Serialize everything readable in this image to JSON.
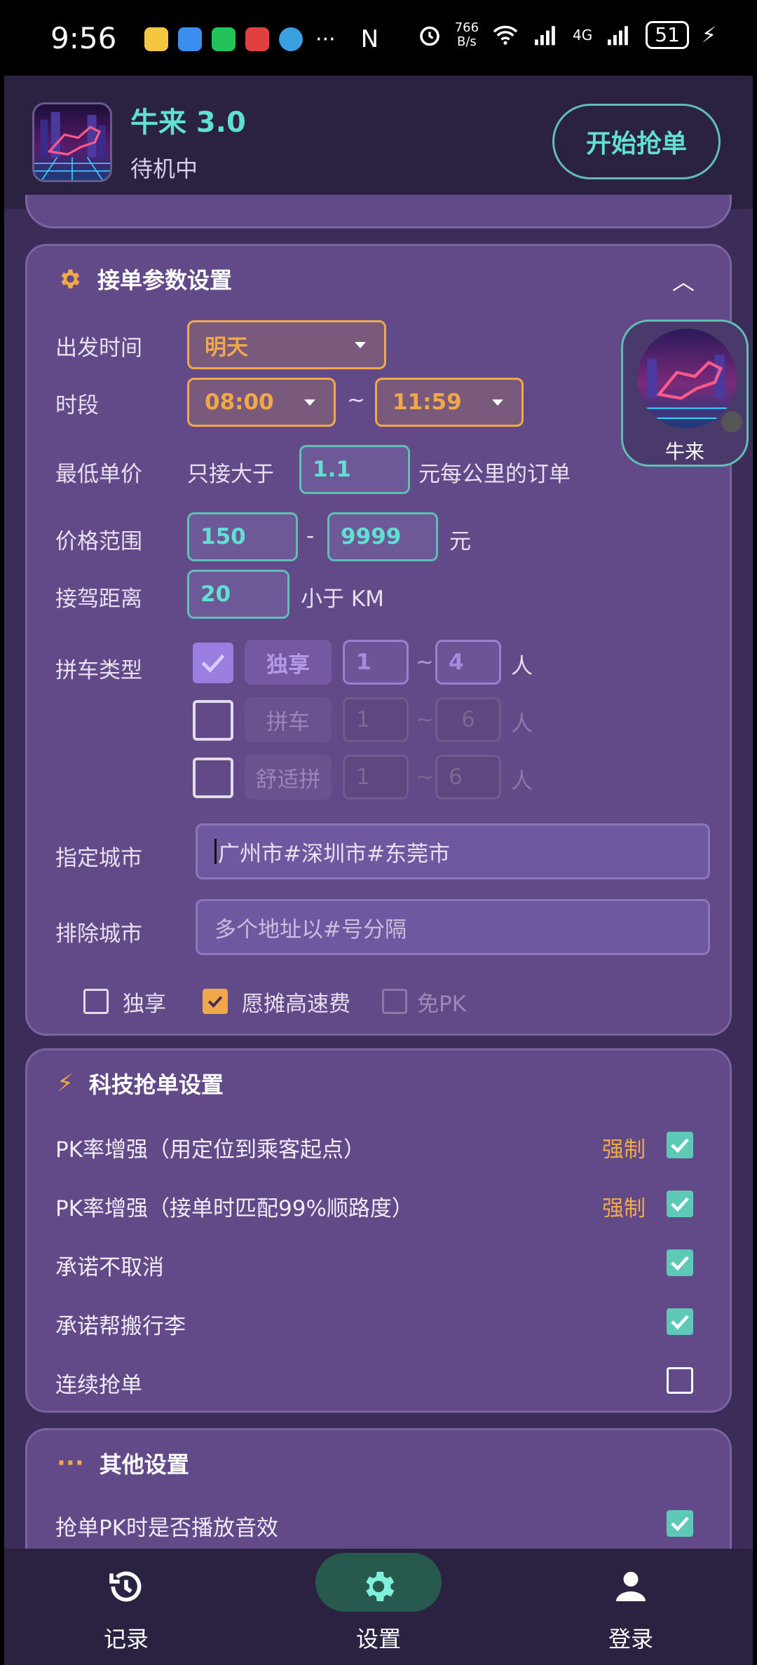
{
  "status_bar": {
    "time": "9:56",
    "more": "···",
    "net_speed_value": "766",
    "net_speed_unit": "B/s",
    "network": "4G",
    "battery": "51"
  },
  "header": {
    "title": "牛来  3.0",
    "status": "待机中",
    "start_button": "开始抢单"
  },
  "params": {
    "title": "接单参数设置",
    "depart_label": "出发时间",
    "depart_value": "明天",
    "period_label": "时段",
    "period_start": "08:00",
    "period_sep": "~",
    "period_end": "11:59",
    "min_price_label": "最低单价",
    "min_price_prefix": "只接大于",
    "min_price_value": "1.1",
    "min_price_suffix": "元每公里的订单",
    "range_label": "价格范围",
    "range_min": "150",
    "range_sep": "-",
    "range_max": "9999",
    "range_unit": "元",
    "pickup_label": "接驾距离",
    "pickup_value": "20",
    "pickup_unit": "小于 KM",
    "carpool_label": "拼车类型",
    "carpool_rows": [
      {
        "name": "独享",
        "min": "1",
        "max": "4",
        "unit": "人",
        "checked": true
      },
      {
        "name": "拼车",
        "min": "1",
        "max": "6",
        "unit": "人",
        "checked": false
      },
      {
        "name": "舒适拼",
        "min": "1",
        "max": "6",
        "unit": "人",
        "checked": false
      }
    ],
    "city_label": "指定城市",
    "city_value": "广州市#深圳市#东莞市",
    "exclude_label": "排除城市",
    "exclude_placeholder": "多个地址以#号分隔",
    "opt_exclusive": "独享",
    "opt_highway": "愿摊高速费",
    "opt_no_pk": "免PK"
  },
  "tech": {
    "title": "科技抢单设置",
    "rows": [
      {
        "label": "PK率增强（用定位到乘客起点）",
        "tag": "强制",
        "checked": true
      },
      {
        "label": "PK率增强（接单时匹配99%顺路度）",
        "tag": "强制",
        "checked": true
      },
      {
        "label": "承诺不取消",
        "tag": "",
        "checked": true
      },
      {
        "label": "承诺帮搬行李",
        "tag": "",
        "checked": true
      },
      {
        "label": "连续抢单",
        "tag": "",
        "checked": false
      }
    ]
  },
  "other": {
    "title": "其他设置",
    "rows": [
      {
        "label": "抢单PK时是否播放音效",
        "checked": true
      }
    ]
  },
  "float_widget": {
    "name": "牛来"
  },
  "nav": {
    "records": "记录",
    "settings": "设置",
    "login": "登录"
  },
  "colors": {
    "background": "#3c2c5a",
    "card": "#624a88",
    "accent_orange": "#f0a84a",
    "accent_teal": "#5fe0d0",
    "check_teal": "#5fc9b8"
  }
}
